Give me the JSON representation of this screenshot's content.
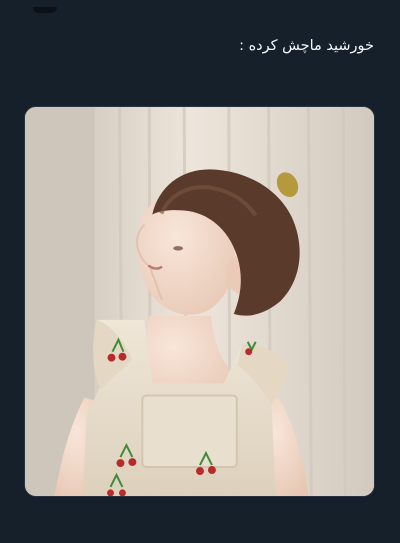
{
  "tweet": {
    "text": "خورشید ماچش کرده :"
  },
  "media": {
    "type": "photo",
    "colors": {
      "background": "#15202b",
      "curtain": "#e9e1d7",
      "wall": "#cfc6bb",
      "skin": "#f1d8c8",
      "hair": "#5a3a2a",
      "dress": "#e8ddc9",
      "cherry": "#b82b2b",
      "stem": "#3f8b3a"
    }
  }
}
